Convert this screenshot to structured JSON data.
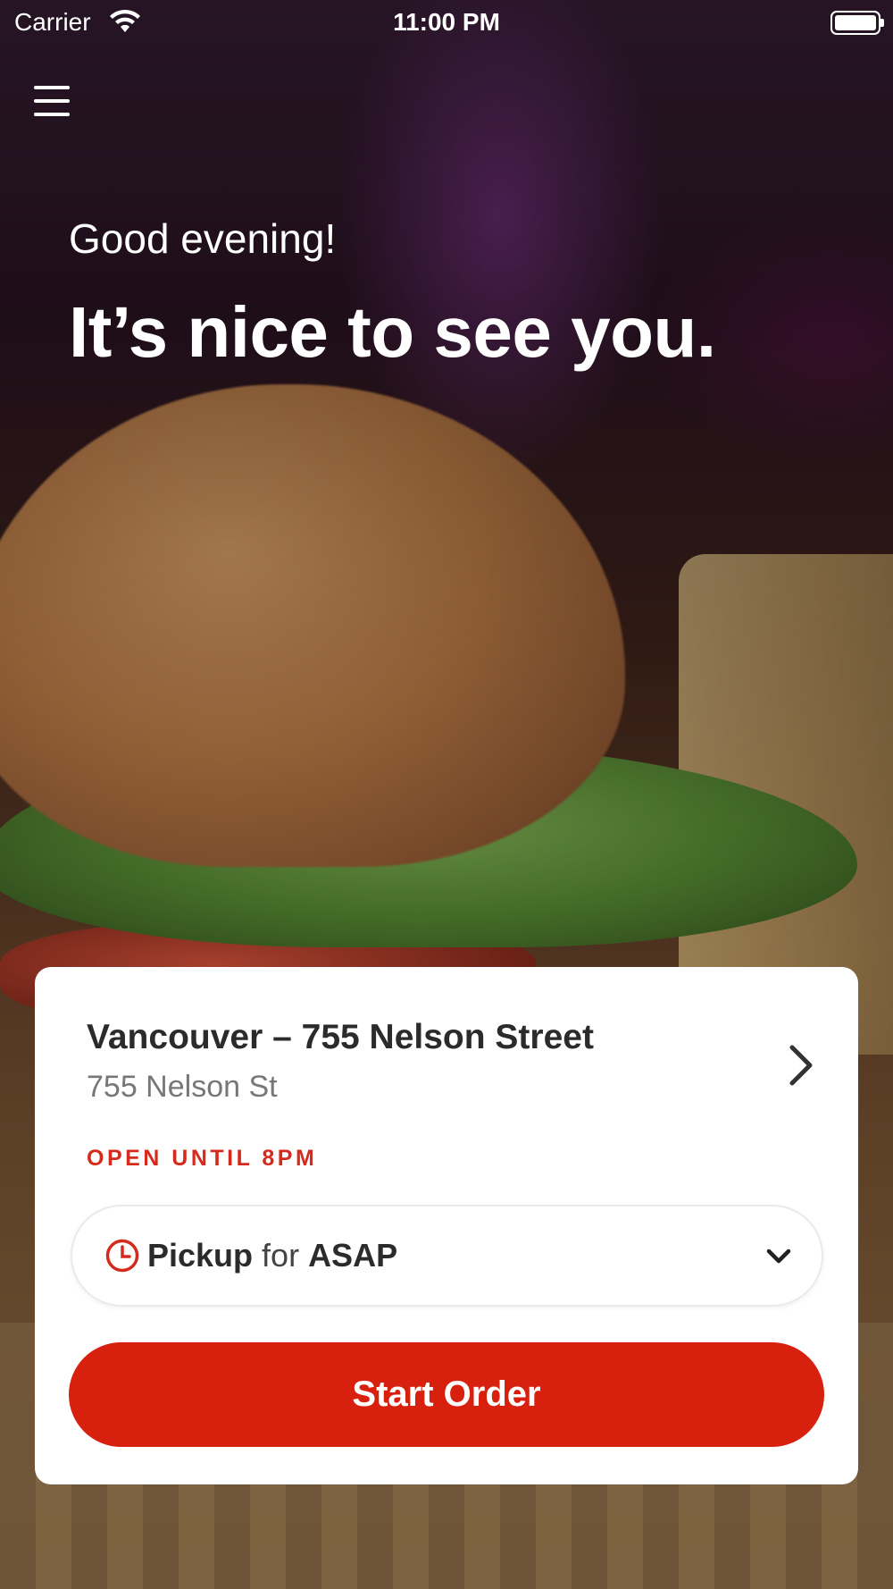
{
  "status_bar": {
    "carrier": "Carrier",
    "time": "11:00 PM",
    "wifi_icon": "wifi-icon",
    "battery_icon": "battery-icon"
  },
  "header": {
    "menu_icon": "hamburger-menu-icon",
    "greeting": "Good evening!",
    "headline": "It’s nice to see you."
  },
  "location_card": {
    "name": "Vancouver – 755 Nelson Street",
    "address": "755 Nelson St",
    "open_status": "OPEN UNTIL 8PM",
    "chevron_icon": "chevron-right-icon"
  },
  "order_mode": {
    "icon": "clock-icon",
    "mode": "Pickup",
    "connector": "for",
    "time": "ASAP",
    "dropdown_icon": "chevron-down-icon"
  },
  "cta": {
    "start_order_label": "Start Order"
  },
  "colors": {
    "accent": "#d8200e",
    "status_text": "#d52b1e",
    "card_bg": "#ffffff"
  }
}
